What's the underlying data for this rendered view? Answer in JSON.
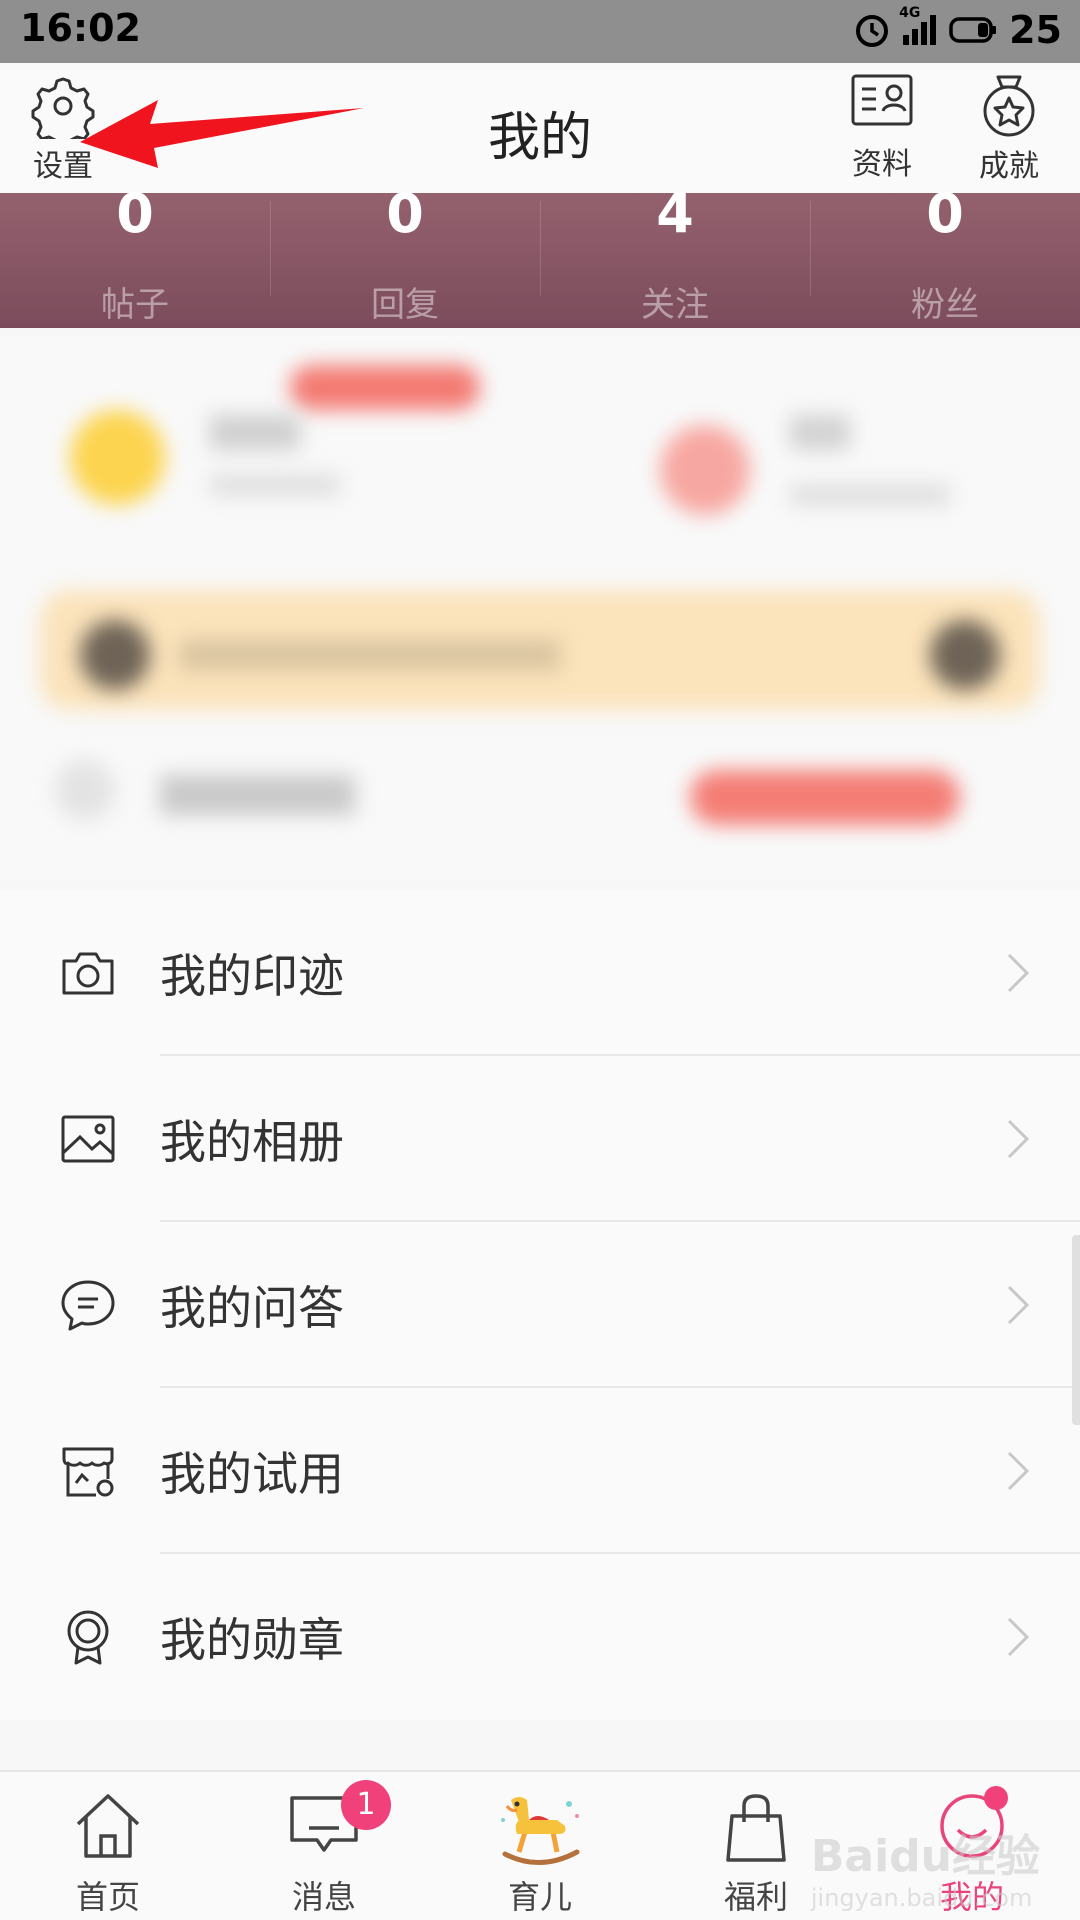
{
  "status_bar": {
    "time": "16:02",
    "network": "4G",
    "battery": "25"
  },
  "header": {
    "title": "我的",
    "settings_label": "设置",
    "profile_label": "资料",
    "achievement_label": "成就"
  },
  "stats": [
    {
      "value": "0",
      "label": "帖子"
    },
    {
      "value": "0",
      "label": "回复"
    },
    {
      "value": "4",
      "label": "关注"
    },
    {
      "value": "0",
      "label": "粉丝"
    }
  ],
  "menu": [
    {
      "label": "我的印迹",
      "icon": "camera-icon"
    },
    {
      "label": "我的相册",
      "icon": "image-icon"
    },
    {
      "label": "我的问答",
      "icon": "chat-bubble-icon"
    },
    {
      "label": "我的试用",
      "icon": "shop-icon"
    },
    {
      "label": "我的勋章",
      "icon": "medal-icon"
    }
  ],
  "bottom_nav": [
    {
      "label": "首页",
      "icon": "home-icon"
    },
    {
      "label": "消息",
      "icon": "message-icon",
      "badge": "1"
    },
    {
      "label": "育儿",
      "icon": "rocking-horse-icon"
    },
    {
      "label": "福利",
      "icon": "shopping-bag-icon"
    },
    {
      "label": "我的",
      "icon": "profile-icon",
      "active": true
    }
  ],
  "watermark": {
    "brand": "Baidu经验",
    "url": "jingyan.baidu.com"
  },
  "colors": {
    "accent": "#e9457a",
    "stats_bg": "#86545f",
    "arrow": "#f0141e"
  }
}
